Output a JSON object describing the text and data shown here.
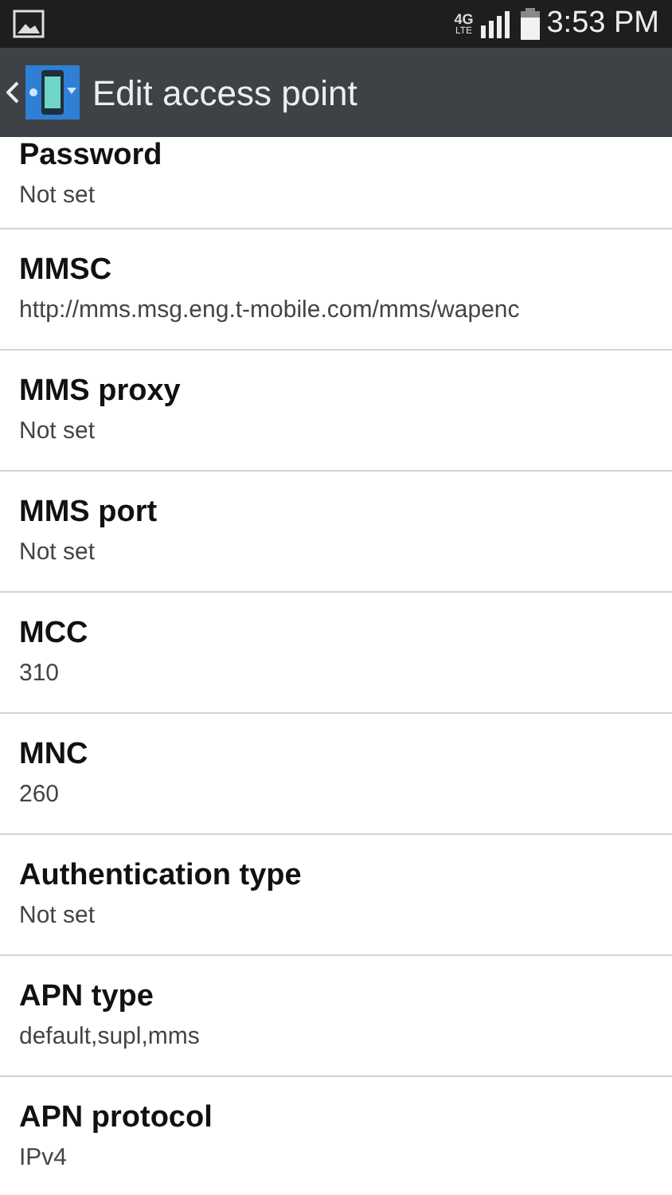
{
  "status_bar": {
    "network_type": "4G",
    "network_sub": "LTE",
    "time": "3:53 PM"
  },
  "action_bar": {
    "title": "Edit access point"
  },
  "settings": [
    {
      "title": "Password",
      "value": "Not set"
    },
    {
      "title": "MMSC",
      "value": "http://mms.msg.eng.t-mobile.com/mms/wapenc"
    },
    {
      "title": "MMS proxy",
      "value": "Not set"
    },
    {
      "title": "MMS port",
      "value": "Not set"
    },
    {
      "title": "MCC",
      "value": "310"
    },
    {
      "title": "MNC",
      "value": "260"
    },
    {
      "title": "Authentication type",
      "value": "Not set"
    },
    {
      "title": "APN type",
      "value": "default,supl,mms"
    },
    {
      "title": "APN protocol",
      "value": "IPv4"
    }
  ]
}
